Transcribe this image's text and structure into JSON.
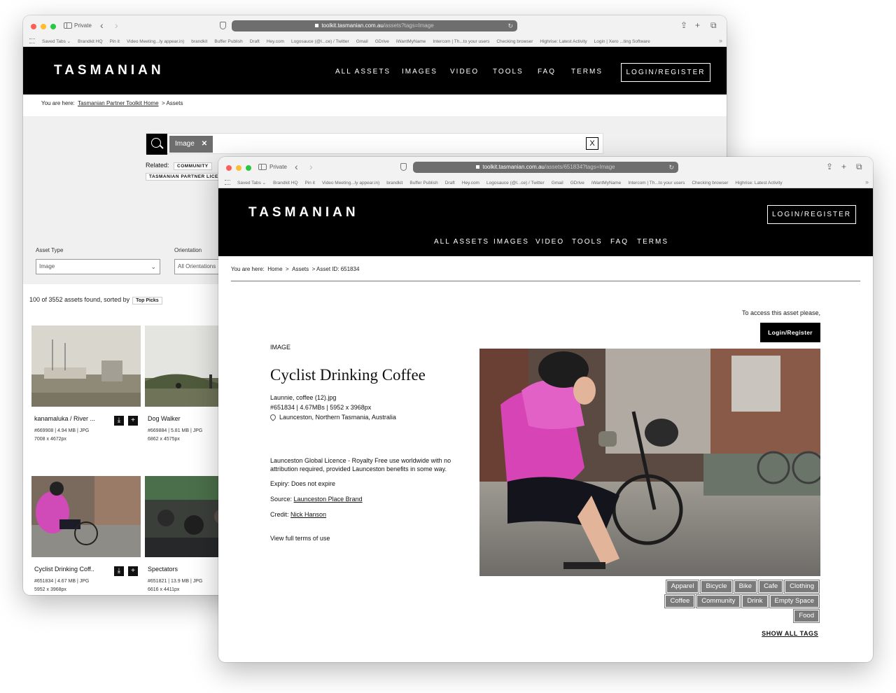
{
  "back_window": {
    "browser": {
      "private_label": "Private",
      "url_host": "toolkit.tasmanian.com.au",
      "url_path": "/assets?tags=Image",
      "favorites": [
        "Saved Tabs ⌄",
        "Brandkit HQ",
        "Pin it",
        "Video Meeting...ly appear.in)",
        "brandkit",
        "Buffer Publish",
        "Draft",
        "Hey.com",
        "Logosauce (@l...ce) / Twitter",
        "Gmail",
        "GDrive",
        "iWantMyName",
        "Intercom | Th...to your users",
        "Checking browser",
        "Highrise: Latest Activity",
        "Login | Xero ...ting Software"
      ]
    },
    "logo": "TASMANIAN",
    "nav": [
      "ALL ASSETS",
      "IMAGES",
      "VIDEO",
      "TOOLS",
      "FAQ",
      "TERMS"
    ],
    "login_label": "LOGIN/REGISTER",
    "breadcrumb": {
      "prefix": "You are here:",
      "home": "Tasmanian Partner Toolkit Home",
      "current": "> Assets"
    },
    "search": {
      "tag": "Image",
      "tag_remove": "✕",
      "clear": "X"
    },
    "related": {
      "label": "Related:",
      "chips": [
        "COMMUNITY",
        "TASMANIAN PARTNER LICENC"
      ]
    },
    "filters": {
      "asset_type_label": "Asset Type",
      "asset_type_value": "Image",
      "orientation_label": "Orientation",
      "orientation_value": "All Orientations"
    },
    "results": {
      "count_text": "100 of 3552 assets found, sorted by",
      "sort_value": "Top Picks"
    },
    "cards": [
      {
        "title": "kanamaluka / River ...",
        "meta1": "#669908 | 4.94 MB | JPG",
        "meta2": "7008 x 4672px"
      },
      {
        "title": "Dog Walker",
        "meta1": "#669884 | 5.81 MB | JPG",
        "meta2": "6862 x 4575px"
      },
      {
        "title": "Cyclist Drinking Coff..",
        "meta1": "#651834 | 4.67 MB | JPG",
        "meta2": "5952 x 3968px"
      },
      {
        "title": "Spectators",
        "meta1": "#651821 | 13.9 MB | JPG",
        "meta2": "6616 x 4411px"
      }
    ]
  },
  "front_window": {
    "browser": {
      "private_label": "Private",
      "url_host": "toolkit.tasmanian.com.au",
      "url_path": "/assets/651834?tags=Image",
      "favorites": [
        "Saved Tabs ⌄",
        "Brandkit HQ",
        "Pin it",
        "Video Meeting...ly appear.in)",
        "brandkit",
        "Buffer Publish",
        "Draft",
        "Hey.com",
        "Logosauce (@l...ce) / Twitter",
        "Gmail",
        "GDrive",
        "iWantMyName",
        "Intercom | Th...to your users",
        "Checking browser",
        "Highrise: Latest Activity"
      ]
    },
    "logo": "TASMANIAN",
    "nav": [
      "ALL ASSETS",
      "IMAGES",
      "VIDEO",
      "TOOLS",
      "FAQ",
      "TERMS"
    ],
    "login_label": "LOGIN/REGISTER",
    "breadcrumb": {
      "prefix": "You are here:",
      "home": "Home",
      "assets": "Assets",
      "current": "Asset ID: 651834"
    },
    "access_text": "To access this asset please,",
    "access_button": "Login/Register",
    "asset": {
      "type": "IMAGE",
      "title": "Cyclist Drinking Coffee",
      "filename": "Launnie, coffee (12).jpg",
      "spec": "#651834 | 4.67MBs | 5952 x 3968px",
      "location": "Launceston,  Northern Tasmania,  Australia",
      "licence": "Launceston Global Licence - Royalty Free use worldwide with no attribution required, provided Launceston benefits in some way.",
      "expiry": "Expiry: Does not expire",
      "source_label": "Source:",
      "source_value": "Launceston Place Brand",
      "credit_label": "Credit:",
      "credit_value": "Nick Hanson",
      "terms_link": "View full terms of use"
    },
    "tags": [
      "Apparel",
      "Bicycle",
      "Bike",
      "Cafe",
      "Clothing",
      "Coffee",
      "Community",
      "Drink",
      "Empty Space",
      "Food"
    ],
    "show_all_tags": "SHOW ALL TAGS"
  }
}
